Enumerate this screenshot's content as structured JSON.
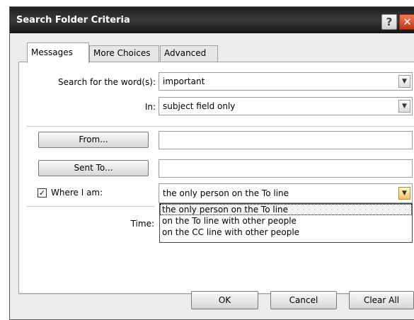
{
  "window": {
    "title": "Search Folder Criteria",
    "help_label": "?",
    "close_label": "✕"
  },
  "tabs": [
    {
      "label": "Messages",
      "active": true
    },
    {
      "label": "More Choices",
      "active": false
    },
    {
      "label": "Advanced",
      "active": false
    }
  ],
  "search": {
    "label": "Search for the word(s):",
    "value": "important",
    "in_label": "In:",
    "in_value": "subject field only"
  },
  "from_button": "From...",
  "from_value": "",
  "sent_to_button": "Sent To...",
  "sent_to_value": "",
  "where": {
    "checked": true,
    "check_glyph": "✓",
    "label": "Where I am:",
    "value": "the only person on the To line",
    "options": [
      "the only person on the To line",
      "on the To line with other people",
      "on the CC line with other people"
    ]
  },
  "time_label": "Time:",
  "dropdown_arrow": "▼",
  "footer": {
    "ok": "OK",
    "cancel": "Cancel",
    "clear_all": "Clear All"
  }
}
